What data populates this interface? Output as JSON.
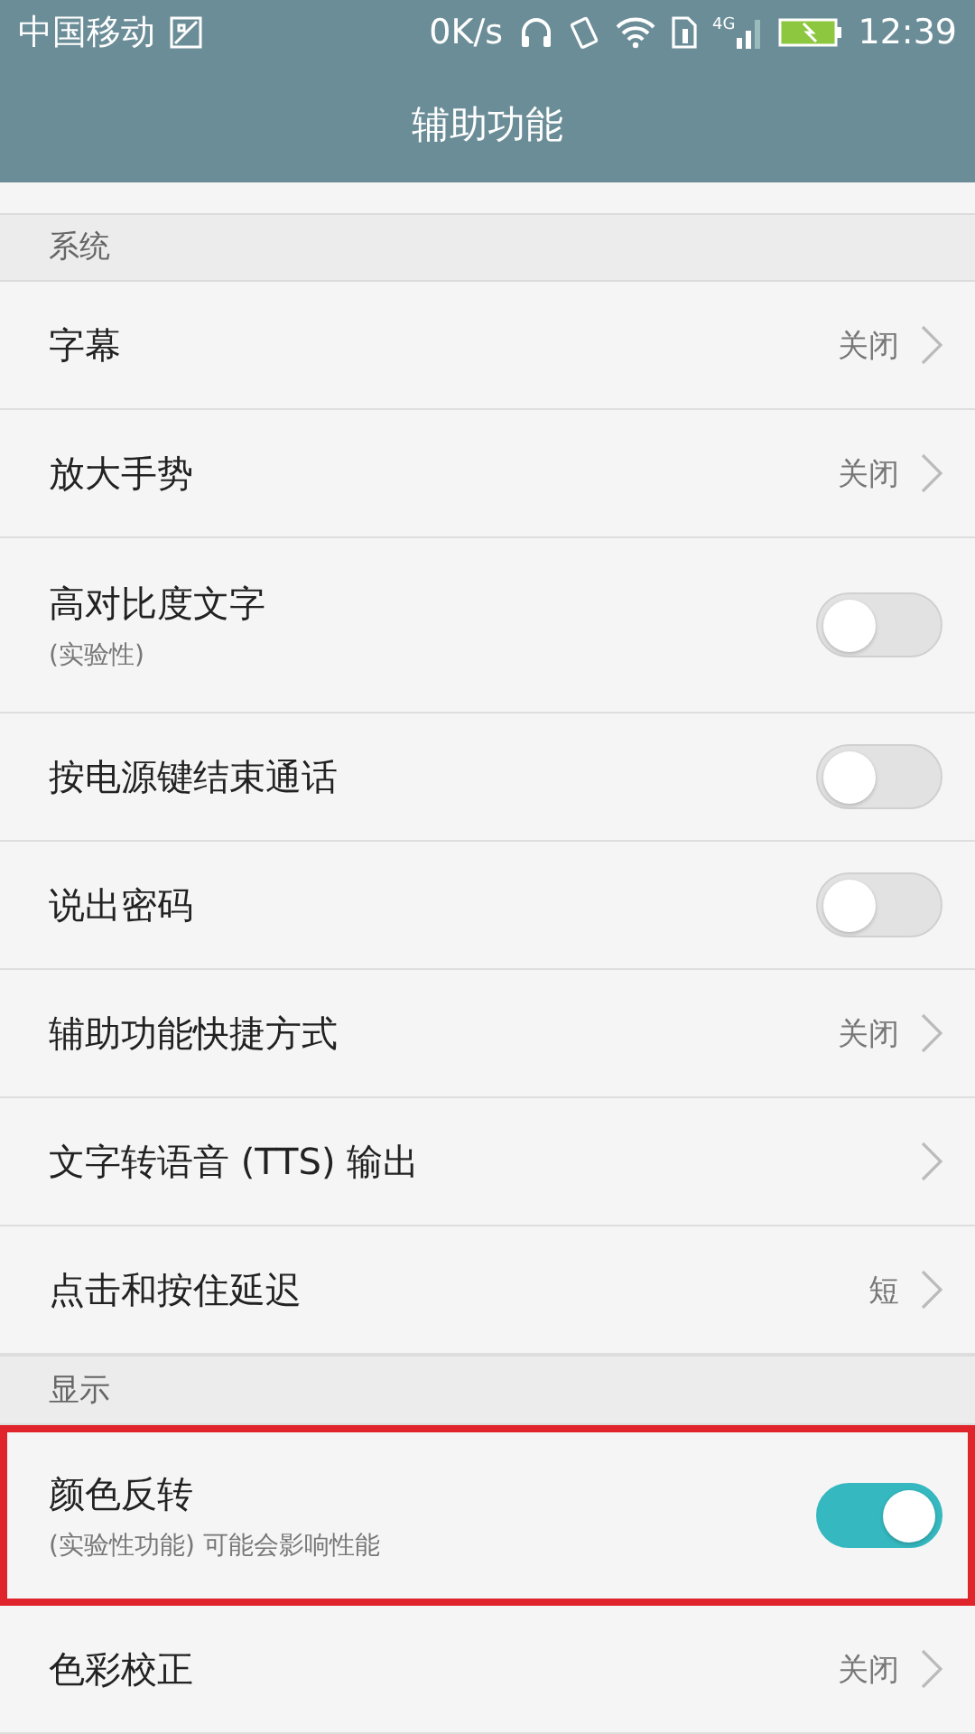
{
  "status_bar": {
    "carrier": "中国移动",
    "speed": "0K/s",
    "network": "4G",
    "time": "12:39"
  },
  "header": {
    "title": "辅助功能"
  },
  "sections": [
    {
      "title": "系统",
      "rows": [
        {
          "kind": "nav",
          "label": "字幕",
          "value": "关闭",
          "highlighted": false
        },
        {
          "kind": "nav",
          "label": "放大手势",
          "value": "关闭",
          "highlighted": false
        },
        {
          "kind": "toggle",
          "label": "高对比度文字",
          "subtitle": "(实验性)",
          "on": false,
          "highlighted": false
        },
        {
          "kind": "toggle",
          "label": "按电源键结束通话",
          "on": false,
          "highlighted": false
        },
        {
          "kind": "toggle",
          "label": "说出密码",
          "on": false,
          "highlighted": false
        },
        {
          "kind": "nav",
          "label": "辅助功能快捷方式",
          "value": "关闭",
          "highlighted": false
        },
        {
          "kind": "nav",
          "label": "文字转语音 (TTS) 输出",
          "highlighted": false
        },
        {
          "kind": "nav",
          "label": "点击和按住延迟",
          "value": "短",
          "highlighted": false
        }
      ]
    },
    {
      "title": "显示",
      "rows": [
        {
          "kind": "toggle",
          "label": "颜色反转",
          "subtitle": "(实验性功能) 可能会影响性能",
          "on": true,
          "highlighted": true
        },
        {
          "kind": "nav",
          "label": "色彩校正",
          "value": "关闭",
          "highlighted": false
        }
      ]
    }
  ]
}
